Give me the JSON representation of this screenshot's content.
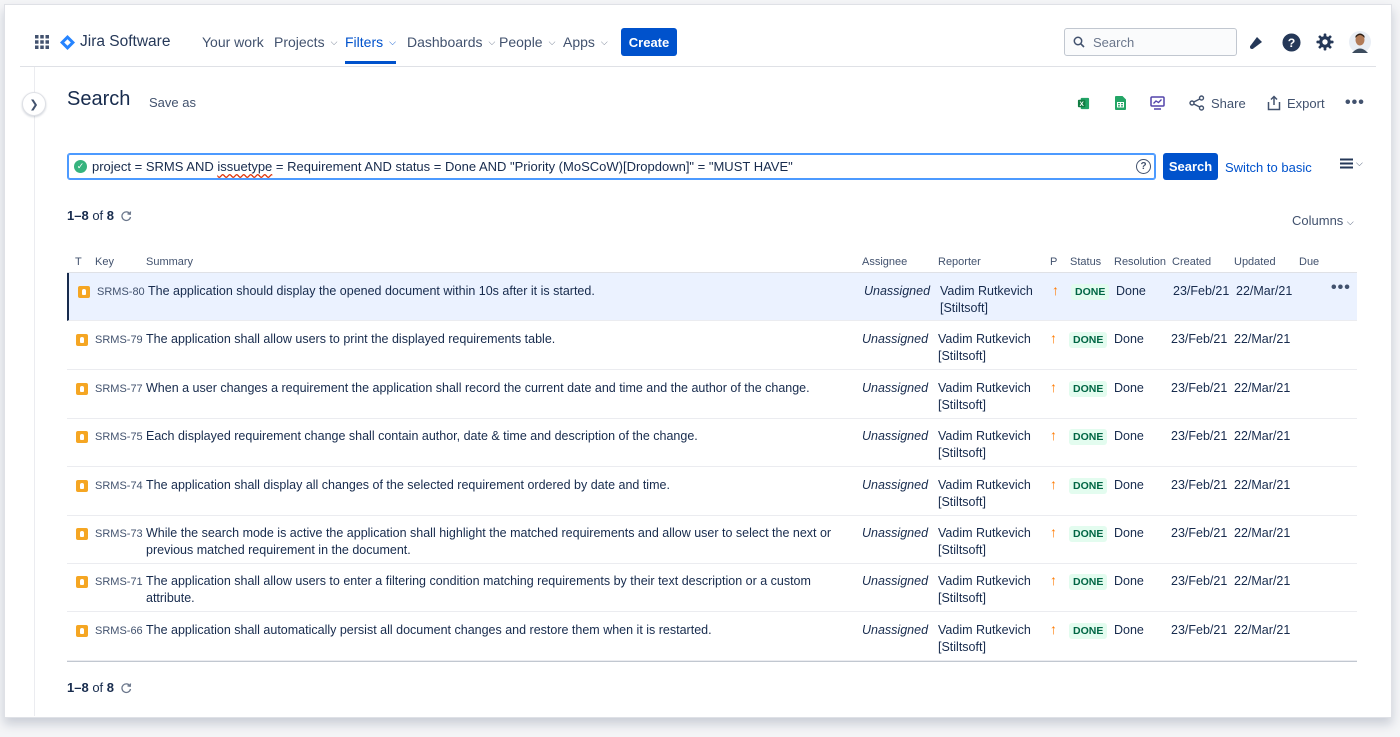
{
  "topbar": {
    "product": "Jira Software",
    "nav": [
      {
        "label": "Your work",
        "dropdown": false
      },
      {
        "label": "Projects",
        "dropdown": true
      },
      {
        "label": "Filters",
        "dropdown": true,
        "active": true
      },
      {
        "label": "Dashboards",
        "dropdown": true
      },
      {
        "label": "People",
        "dropdown": true
      },
      {
        "label": "Apps",
        "dropdown": true
      }
    ],
    "create_label": "Create",
    "search_placeholder": "Search"
  },
  "page": {
    "title": "Search",
    "save_as": "Save as",
    "share_label": "Share",
    "export_label": "Export"
  },
  "query": {
    "prefix": "project = SRMS AND ",
    "underlined": "issuetype",
    "suffix": " = Requirement AND status = Done AND \"Priority (MoSCoW)[Dropdown]\" = \"MUST HAVE\"",
    "search_button": "Search",
    "switch_label": "Switch to basic"
  },
  "results": {
    "range": "1–8",
    "of": "of",
    "total": "8",
    "columns_label": "Columns"
  },
  "table": {
    "headers": {
      "type": "T",
      "key": "Key",
      "summary": "Summary",
      "assignee": "Assignee",
      "reporter": "Reporter",
      "priority": "P",
      "status": "Status",
      "resolution": "Resolution",
      "created": "Created",
      "updated": "Updated",
      "due": "Due"
    },
    "rows": [
      {
        "key": "SRMS-80",
        "summary": "The application should display the opened document within 10s after it is started.",
        "assignee": "Unassigned",
        "reporter": "Vadim Rutkevich [Stiltsoft]",
        "status": "DONE",
        "resolution": "Done",
        "created": "23/Feb/21",
        "updated": "22/Mar/21"
      },
      {
        "key": "SRMS-79",
        "summary": "The application shall allow users to print the displayed requirements table.",
        "assignee": "Unassigned",
        "reporter": "Vadim Rutkevich [Stiltsoft]",
        "status": "DONE",
        "resolution": "Done",
        "created": "23/Feb/21",
        "updated": "22/Mar/21"
      },
      {
        "key": "SRMS-77",
        "summary": "When a user changes a requirement the application shall record the current date and time and the author of the change.",
        "assignee": "Unassigned",
        "reporter": "Vadim Rutkevich [Stiltsoft]",
        "status": "DONE",
        "resolution": "Done",
        "created": "23/Feb/21",
        "updated": "22/Mar/21"
      },
      {
        "key": "SRMS-75",
        "summary": "Each displayed requirement change shall contain author, date & time and description of the change.",
        "assignee": "Unassigned",
        "reporter": "Vadim Rutkevich [Stiltsoft]",
        "status": "DONE",
        "resolution": "Done",
        "created": "23/Feb/21",
        "updated": "22/Mar/21"
      },
      {
        "key": "SRMS-74",
        "summary": "The application shall display all changes of the selected requirement ordered by date and time.",
        "assignee": "Unassigned",
        "reporter": "Vadim Rutkevich [Stiltsoft]",
        "status": "DONE",
        "resolution": "Done",
        "created": "23/Feb/21",
        "updated": "22/Mar/21"
      },
      {
        "key": "SRMS-73",
        "summary": "While the search mode is active the application shall highlight the matched requirements and allow user to select the next or previous matched requirement in the document.",
        "assignee": "Unassigned",
        "reporter": "Vadim Rutkevich [Stiltsoft]",
        "status": "DONE",
        "resolution": "Done",
        "created": "23/Feb/21",
        "updated": "22/Mar/21"
      },
      {
        "key": "SRMS-71",
        "summary": "The application shall allow users to enter a filtering condition matching requirements by their text description or a custom attribute.",
        "assignee": "Unassigned",
        "reporter": "Vadim Rutkevich [Stiltsoft]",
        "status": "DONE",
        "resolution": "Done",
        "created": "23/Feb/21",
        "updated": "22/Mar/21"
      },
      {
        "key": "SRMS-66",
        "summary": "The application shall automatically persist all document changes and restore them when it is restarted.",
        "assignee": "Unassigned",
        "reporter": "Vadim Rutkevich [Stiltsoft]",
        "status": "DONE",
        "resolution": "Done",
        "created": "23/Feb/21",
        "updated": "22/Mar/21"
      }
    ]
  },
  "colors": {
    "accent": "#0052cc",
    "status_done_text": "#006644",
    "status_done_bg": "#e3fcef",
    "priority_high": "#ff7a00",
    "requirement_type": "#f5a623"
  }
}
